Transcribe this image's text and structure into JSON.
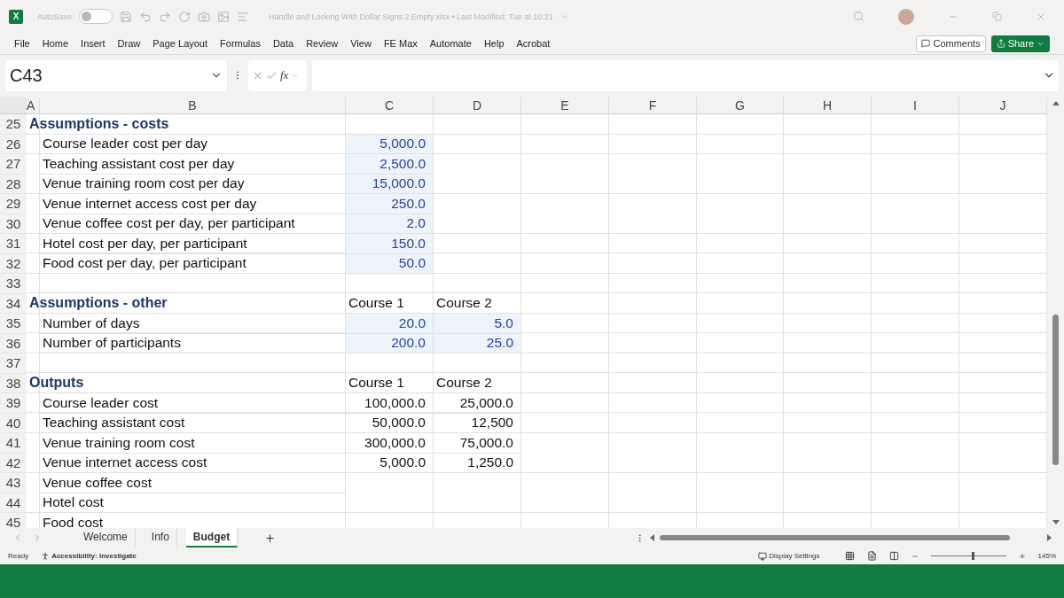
{
  "title_bar": {
    "app_icon": "X",
    "autosave_label": "AutoSave",
    "autosave_on": false,
    "title": "Handle and Locking With Dollar Signs 2 Empty.xlsx • Last Modified: Tue at 10:21"
  },
  "ribbon_tabs": [
    "File",
    "Home",
    "Insert",
    "Draw",
    "Page Layout",
    "Formulas",
    "Data",
    "Review",
    "View",
    "FE Max",
    "Automate",
    "Help",
    "Acrobat"
  ],
  "comments_button": "Comments",
  "share_button": "Share",
  "formula_bar": {
    "name_box": "C43",
    "fx": "fx"
  },
  "columns": [
    "A",
    "B",
    "C",
    "D",
    "E",
    "F",
    "G",
    "H",
    "I",
    "J"
  ],
  "rows": [
    {
      "num": "25",
      "kind": "heading",
      "label": "Assumptions - costs"
    },
    {
      "num": "26",
      "kind": "item",
      "label": "Course leader cost per day",
      "c": {
        "text": "5,000.0",
        "input": true
      }
    },
    {
      "num": "27",
      "kind": "item",
      "label": "Teaching assistant cost per day",
      "c": {
        "text": "2,500.0",
        "input": true
      }
    },
    {
      "num": "28",
      "kind": "item",
      "label": "Venue training room cost per day",
      "c": {
        "text": "15,000.0",
        "input": true
      }
    },
    {
      "num": "29",
      "kind": "item",
      "label": "Venue internet access cost per day",
      "c": {
        "text": "250.0",
        "input": true
      }
    },
    {
      "num": "30",
      "kind": "item",
      "label": "Venue coffee cost per day, per participant",
      "c": {
        "text": "2.0",
        "input": true
      }
    },
    {
      "num": "31",
      "kind": "item",
      "label": "Hotel cost per day, per participant",
      "c": {
        "text": "150.0",
        "input": true
      }
    },
    {
      "num": "32",
      "kind": "item",
      "label": "Food cost per day, per participant",
      "c": {
        "text": "50.0",
        "input": true
      }
    },
    {
      "num": "33",
      "kind": "blank"
    },
    {
      "num": "34",
      "kind": "heading",
      "label": "Assumptions - other",
      "c": {
        "text": "Course 1",
        "input": false,
        "left": true
      },
      "d": {
        "text": "Course 2",
        "input": false,
        "left": true
      }
    },
    {
      "num": "35",
      "kind": "item",
      "label": "Number of days",
      "c": {
        "text": "20.0",
        "input": true
      },
      "d": {
        "text": "5.0",
        "input": true
      }
    },
    {
      "num": "36",
      "kind": "item",
      "label": "Number of participants",
      "c": {
        "text": "200.0",
        "input": true
      },
      "d": {
        "text": "25.0",
        "input": true
      }
    },
    {
      "num": "37",
      "kind": "blank"
    },
    {
      "num": "38",
      "kind": "heading",
      "label": "Outputs",
      "c": {
        "text": "Course 1",
        "input": false,
        "left": true
      },
      "d": {
        "text": "Course 2",
        "input": false,
        "left": true
      }
    },
    {
      "num": "39",
      "kind": "item",
      "label": "Course leader cost",
      "c": {
        "text": "100,000.0",
        "input": false
      },
      "d": {
        "text": "25,000.0",
        "input": false
      }
    },
    {
      "num": "40",
      "kind": "item",
      "label": "Teaching assistant cost",
      "c": {
        "text": "50,000.0",
        "input": false
      },
      "d": {
        "text": "12,500",
        "input": false
      }
    },
    {
      "num": "41",
      "kind": "item",
      "label": "Venue training room cost",
      "c": {
        "text": "300,000.0",
        "input": false
      },
      "d": {
        "text": "75,000.0",
        "input": false
      }
    },
    {
      "num": "42",
      "kind": "item",
      "label": "Venue internet access cost",
      "c": {
        "text": "5,000.0",
        "input": false
      },
      "d": {
        "text": "1,250.0",
        "input": false
      }
    },
    {
      "num": "43",
      "kind": "item",
      "label": "Venue coffee cost"
    },
    {
      "num": "44",
      "kind": "item",
      "label": "Hotel cost"
    },
    {
      "num": "45",
      "kind": "item",
      "label": "Food cost"
    }
  ],
  "sheet_tabs": [
    {
      "label": "Welcome",
      "selected": false
    },
    {
      "label": "Info",
      "selected": false
    },
    {
      "label": "Budget",
      "selected": true
    }
  ],
  "status_bar": {
    "mode": "Ready",
    "accessibility": "Accessibility: Investigate",
    "display_settings": "Display Settings",
    "zoom": {
      "level": 0.55,
      "reading": "145%"
    }
  }
}
